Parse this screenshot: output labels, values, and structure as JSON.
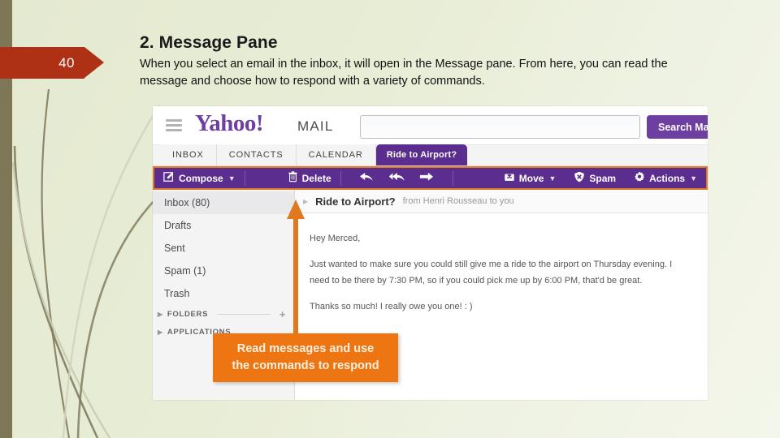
{
  "slide": {
    "number": "40",
    "title": "2. Message Pane",
    "subtitle": "When you select an email in the inbox, it will open in the Message pane. From here, you can read the message and choose how to respond with a variety of commands."
  },
  "colors": {
    "banner_red": "#ae3115",
    "background_green": "#e6ebd2",
    "stripe_olive": "#7d7757",
    "yahoo_purple": "#6c3fa0",
    "toolbar_purple": "#5b2d8e",
    "highlight_orange": "#e07820",
    "callout_orange": "#ed7612"
  },
  "mail": {
    "header": {
      "menu_icon": "hamburger-icon",
      "logo": "Yahoo!",
      "logo_suffix": "MAIL",
      "search_value": "",
      "search_placeholder": "",
      "search_button_label": "Search Mail"
    },
    "tabs": [
      {
        "label": "INBOX",
        "active": false
      },
      {
        "label": "CONTACTS",
        "active": false
      },
      {
        "label": "CALENDAR",
        "active": false
      },
      {
        "label": "Ride to Airport?",
        "active": true
      }
    ],
    "toolbar": {
      "compose_label": "Compose",
      "compose_icon": "compose-pencil-icon",
      "delete_label": "Delete",
      "delete_icon": "trash-icon",
      "reply_icon": "reply-arrow-icon",
      "reply_all_icon": "reply-all-arrow-icon",
      "forward_icon": "forward-arrow-icon",
      "move_label": "Move",
      "move_icon": "move-folder-icon",
      "spam_label": "Spam",
      "spam_icon": "spam-shield-icon",
      "actions_label": "Actions",
      "actions_icon": "gear-icon",
      "caret_icon": "chevron-down-icon"
    },
    "sidebar": {
      "folders": [
        {
          "label": "Inbox (80)",
          "selected": true
        },
        {
          "label": "Drafts",
          "selected": false
        },
        {
          "label": "Sent",
          "selected": false
        },
        {
          "label": "Spam (1)",
          "selected": false
        },
        {
          "label": "Trash",
          "selected": false
        }
      ],
      "sections": [
        {
          "label": "FOLDERS",
          "has_add": true,
          "add_icon": "plus-icon"
        },
        {
          "label": "APPLICATIONS",
          "has_add": false
        }
      ]
    },
    "message": {
      "subject": "Ride to Airport?",
      "from_line": "from Henri Rousseau to you",
      "greeting": "Hey Merced,",
      "paragraph1": "Just wanted to make sure you could still give me a ride to the airport on Thursday evening. I need to be there by 7:30 PM, so if you could pick me up by 6:00 PM, that'd be great.",
      "paragraph2": "Thanks so much! I really owe you one! : )"
    }
  },
  "annotation": {
    "callout_line1": "Read messages and use",
    "callout_line2": "the commands to respond",
    "arrow_icon": "up-arrow-icon"
  }
}
